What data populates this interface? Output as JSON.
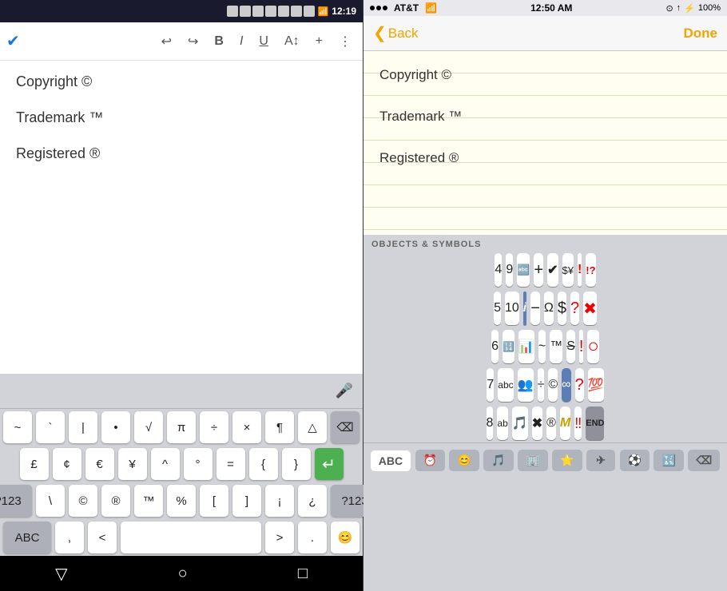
{
  "android": {
    "statusBar": {
      "time": "12:19"
    },
    "toolbar": {
      "checkmark": "✔",
      "undo": "↩",
      "redo": "↪",
      "bold": "B",
      "italic": "I",
      "underline": "U",
      "textSize": "A↕",
      "add": "+",
      "more": "⋮"
    },
    "editor": {
      "lines": [
        "Copyright ©",
        "Trademark ™",
        "Registered ®"
      ]
    },
    "keyboard": {
      "row1": [
        "~",
        "`",
        "|",
        "•",
        "√",
        "π",
        "÷",
        "×",
        "¶",
        "△",
        "⌫"
      ],
      "row2": [
        "£",
        "¢",
        "€",
        "¥",
        "^",
        "°",
        "=",
        "{",
        "}",
        "↵"
      ],
      "row3label": "?123",
      "row3": [
        "\\",
        "©",
        "®",
        "™",
        "%",
        "[",
        "]",
        "¡",
        "¿"
      ],
      "row3end": "?123",
      "row4": [
        "ABC",
        ",",
        "<",
        "space",
        ">",
        ".",
        "😊"
      ]
    },
    "navBar": {
      "back": "▽",
      "home": "○",
      "recent": "□"
    }
  },
  "ios": {
    "statusBar": {
      "signals": "●●●",
      "carrier": "AT&T",
      "wifi": "WiFi",
      "time": "12:50 AM",
      "location": "⊙",
      "bluetooth": "Bluetooth",
      "battery": "100%"
    },
    "navBar": {
      "back": "Back",
      "done": "Done"
    },
    "notes": {
      "lines": [
        "Copyright ©",
        "Trademark ™",
        "Registered ®"
      ]
    },
    "emojiKeyboard": {
      "sectionHeader": "OBJECTS & SYMBOLS",
      "rows": [
        [
          "4",
          "9",
          "🔤",
          "+",
          "✔",
          "$¥",
          "!",
          "!?"
        ],
        [
          "5",
          "10",
          "ℹ",
          "−",
          "Ω",
          "$",
          "?",
          "✖"
        ],
        [
          "6",
          "🔢",
          "📊",
          "~",
          "™",
          "℃",
          "!",
          "○"
        ],
        [
          "7",
          "abc",
          "👥",
          "÷",
          "©",
          "∞",
          "?",
          "💯"
        ],
        [
          "8",
          "🔤",
          "🎵",
          "✖",
          "®",
          "M",
          "‼",
          "END"
        ]
      ]
    },
    "bottomBar": {
      "abc": "ABC",
      "clock": "⏰",
      "emoji": "😊",
      "music": "🎵",
      "building": "🏢",
      "star": "⭐",
      "plane": "✈",
      "sports": "⚽",
      "symbols": "🔣",
      "delete": "⌫"
    }
  }
}
